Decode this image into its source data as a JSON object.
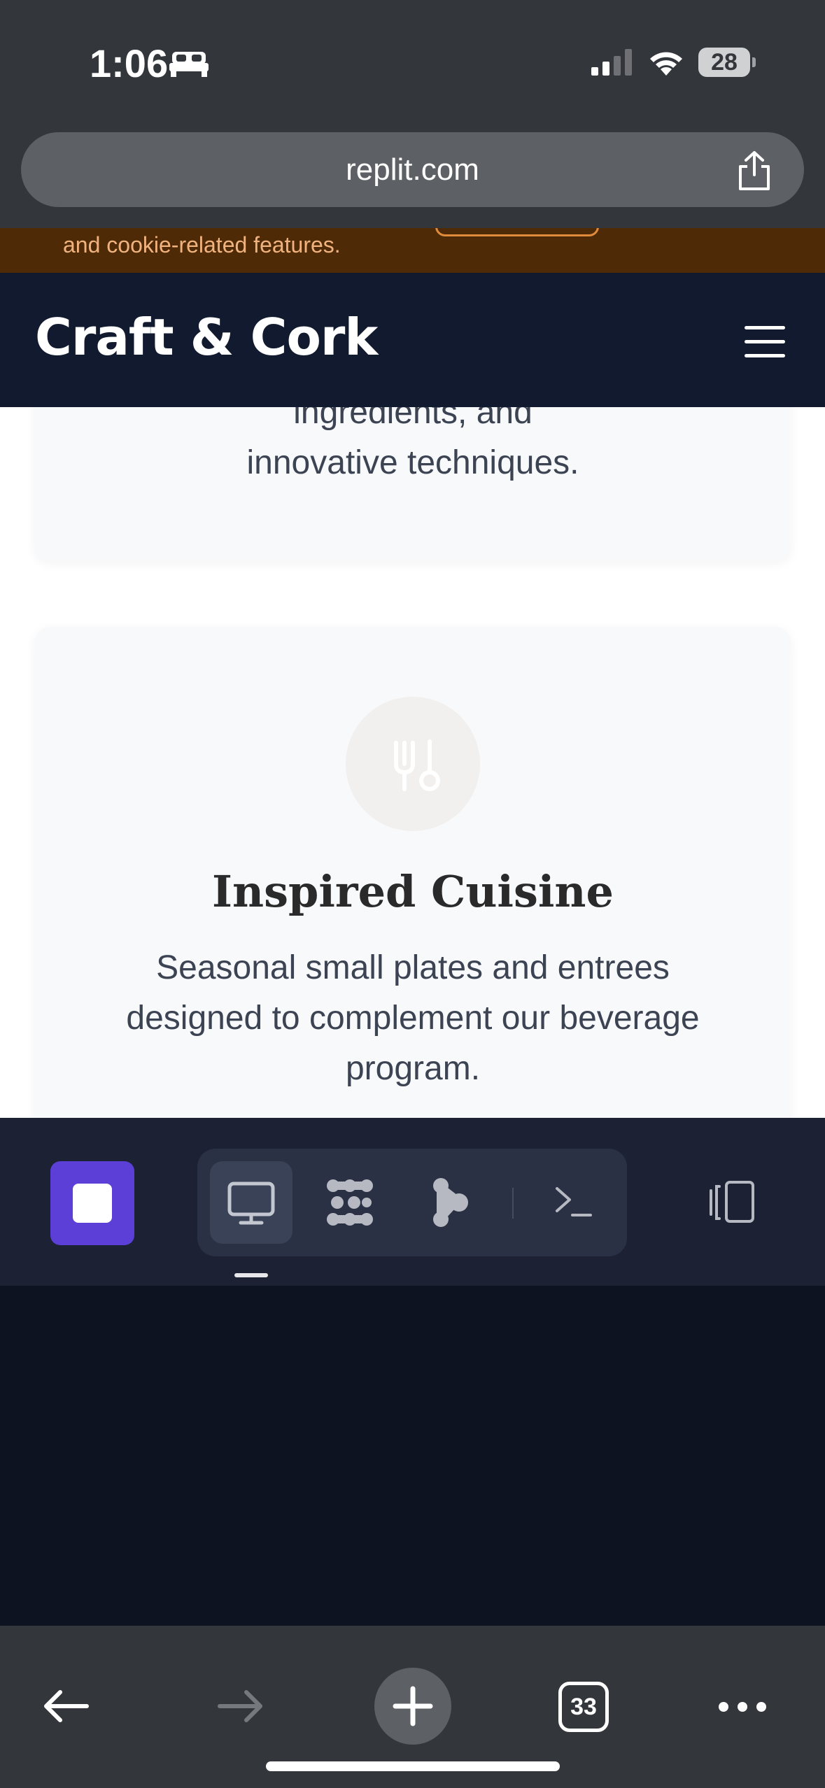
{
  "status_bar": {
    "time": "1:06",
    "battery": "28"
  },
  "browser": {
    "url": "replit.com",
    "tab_count": "33"
  },
  "page": {
    "cookie_banner": {
      "text": "and cookie-related features."
    },
    "header": {
      "brand": "Craft & Cork"
    },
    "card_top": {
      "text": "ingredients, and innovative techniques."
    },
    "card_bottom": {
      "icon": "utensils-icon",
      "title": "Inspired Cuisine",
      "description": "Seasonal small plates and entrees designed to complement our beverage program."
    }
  },
  "replit_toolbar": {
    "tools": [
      "preview-icon",
      "agent-icon",
      "git-icon",
      "shell-icon"
    ],
    "active_tool": "preview-icon"
  },
  "colors": {
    "accent": "#5b3fd6",
    "header_bg": "#111a2e",
    "cookie_bg": "#4f2a06"
  }
}
